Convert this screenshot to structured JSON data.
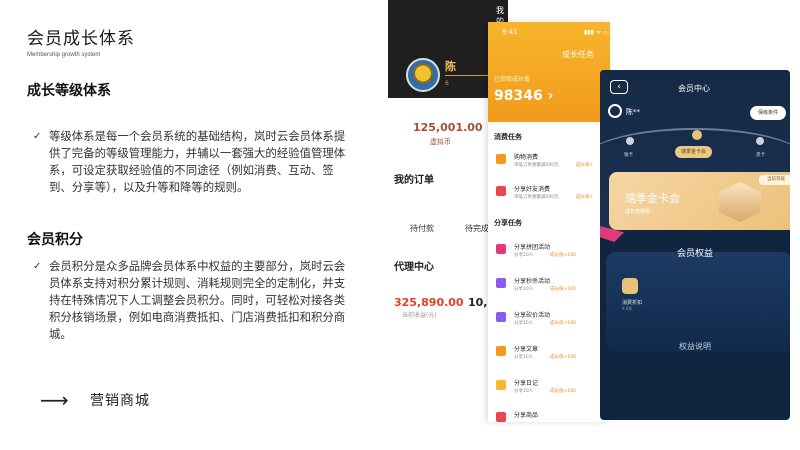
{
  "header": {
    "title": "会员成长体系",
    "subtitle": "Membership growth system"
  },
  "sections": [
    {
      "heading": "成长等级体系",
      "bullet": "等级体系是每一个会员系统的基础结构，岚时云会员体系提供了完备的等级管理能力，并辅以一套强大的经验值管理体系，可设定获取经验值的不同途径（例如消费、互动、签到、分享等），以及升等和降等的规则。"
    },
    {
      "heading": "会员积分",
      "bullet": "会员积分是众多品牌会员体系中权益的主要部分，岚时云会员体系支持对积分累计规则、消耗规则完全的定制化，并支持在特殊情况下人工调整会员积分。同时，可轻松对接各类积分核销场景，例如电商消费抵扣、门店消费抵扣和积分商城。"
    }
  ],
  "link": {
    "arrow": "⟶",
    "label": "营销商城"
  },
  "phone_mine": {
    "title": "我的",
    "user_name": "陈",
    "user_level": "6",
    "coin_value": "125,001.00",
    "coin_label": "虚拟币",
    "orders_title": "我的订单",
    "tabs": [
      "待付款",
      "待完成"
    ],
    "agent_title": "代理中心",
    "amount": "325,890.00",
    "amount2": "10,1",
    "amount_label": "当前收益(元)"
  },
  "phone_tasks": {
    "time": "9:41",
    "signal": "▮▮▮ ᯤ ▭",
    "title": "成长任务",
    "earned_label": "已获取成长值",
    "points": "98346 ›",
    "consume_title": "消费任务",
    "share_title": "分享任务",
    "consume_tasks": [
      {
        "name": "购物消费",
        "desc": "单笔订单金额满500元",
        "reward": "成长值+",
        "color": "#f29a1c"
      },
      {
        "name": "分享好友消费",
        "desc": "单笔订单金额满500元",
        "reward": "成长值+",
        "color": "#e5484d"
      }
    ],
    "share_tasks": [
      {
        "name": "分享拼团活动",
        "desc": "分享10人",
        "reward": "成长值+100",
        "color": "#e03a78"
      },
      {
        "name": "分享秒杀活动",
        "desc": "分享10人",
        "reward": "成长值+100",
        "color": "#8a5cf0"
      },
      {
        "name": "分享砍价活动",
        "desc": "分享10人",
        "reward": "成长值+100",
        "color": "#8a5cf0"
      },
      {
        "name": "分享文章",
        "desc": "分享10人",
        "reward": "成长值+100",
        "color": "#f29a1c"
      },
      {
        "name": "分享日记",
        "desc": "分享10人",
        "reward": "成长值+100",
        "color": "#f5b82e"
      },
      {
        "name": "分享商品",
        "desc": "",
        "reward": "",
        "color": "#e5484d"
      }
    ]
  },
  "phone_center": {
    "back": "‹",
    "title": "会员中心",
    "user_name": "陈**",
    "conditions_button": "保级条件",
    "levels": [
      "银卡",
      "瑞季金卡会",
      "黑卡"
    ],
    "current_level": "瑞季金卡会",
    "card_name": "瑞季金卡会",
    "card_sub": "成长值规则 ›",
    "current_tag": "当前等级",
    "rights_title": "会员权益",
    "right_label": "消费折扣",
    "right_sub": "9.0折",
    "rights_explain": "权益说明"
  }
}
